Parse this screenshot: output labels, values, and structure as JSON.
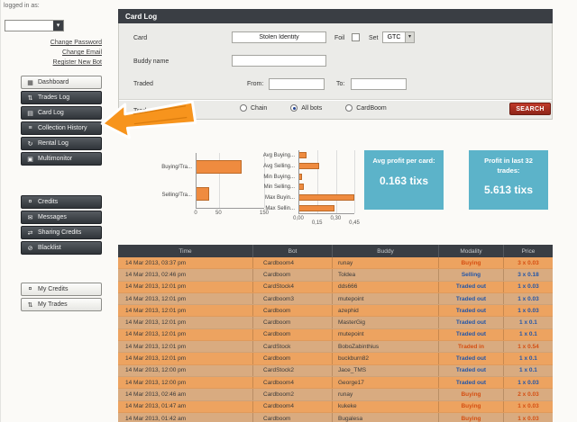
{
  "account": {
    "logged_in_label": "logged in as:",
    "links": [
      "Change Password",
      "Change Email",
      "Register New Bot"
    ]
  },
  "sidebar": {
    "groups": [
      [
        {
          "name": "dashboard",
          "label": "Dashboard",
          "icon": "dashboard-icon",
          "glyph": "▦",
          "style": "light"
        },
        {
          "name": "trades-log",
          "label": "Trades Log",
          "icon": "trades-icon",
          "glyph": "⇅",
          "style": "dark"
        },
        {
          "name": "card-log",
          "label": "Card Log",
          "icon": "card-icon",
          "glyph": "▤",
          "style": "dark"
        },
        {
          "name": "collection-history",
          "label": "Collection History",
          "icon": "history-icon",
          "glyph": "≡",
          "style": "dark"
        },
        {
          "name": "rental-log",
          "label": "Rental Log",
          "icon": "rental-icon",
          "glyph": "↻",
          "style": "dark"
        },
        {
          "name": "multimonitor",
          "label": "Multimonitor",
          "icon": "monitor-icon",
          "glyph": "▣",
          "style": "dark"
        }
      ],
      [
        {
          "name": "credits",
          "label": "Credits",
          "icon": "credits-icon",
          "glyph": "¤",
          "style": "dark"
        },
        {
          "name": "messages",
          "label": "Messages",
          "icon": "messages-icon",
          "glyph": "✉",
          "style": "dark"
        },
        {
          "name": "sharing-credits",
          "label": "Sharing Credits",
          "icon": "sharing-icon",
          "glyph": "⇄",
          "style": "dark"
        },
        {
          "name": "blacklist",
          "label": "Blacklist",
          "icon": "blacklist-icon",
          "glyph": "⊘",
          "style": "dark"
        }
      ],
      [
        {
          "name": "my-credits",
          "label": "My Credits",
          "icon": "my-credits-icon",
          "glyph": "¤",
          "style": "light"
        },
        {
          "name": "my-trades",
          "label": "My Trades",
          "icon": "my-trades-icon",
          "glyph": "⇅",
          "style": "light"
        }
      ]
    ]
  },
  "form": {
    "title": "Card Log",
    "card_label": "Card",
    "card_value": "Stolen Identity",
    "foil_label": "Foil",
    "foil_checked": false,
    "set_label": "Set",
    "set_value": "GTC",
    "buddy_label": "Buddy name",
    "buddy_value": "",
    "traded_label": "Traded",
    "from_label": "From:",
    "from_value": "",
    "to_label": "To:",
    "to_value": "",
    "trades_for_label": "Trades for",
    "trades_for_options": [
      {
        "label": "Chain",
        "selected": false
      },
      {
        "label": "All bots",
        "selected": true
      },
      {
        "label": "CardBoom",
        "selected": false
      }
    ],
    "search_label": "SEARCH"
  },
  "chart_data": [
    {
      "type": "bar",
      "orientation": "horizontal",
      "title": "",
      "categories": [
        "Buying/Tra...",
        "Selling/Tra..."
      ],
      "values": [
        100,
        28
      ],
      "xlim": [
        0,
        150
      ],
      "tick_labels": [
        "0",
        "50",
        "150"
      ],
      "tick_values": [
        0,
        50,
        150
      ],
      "stagger_ticks": false,
      "bar_color": "#ef8b3f",
      "grid": true,
      "legend": "none"
    },
    {
      "type": "bar",
      "orientation": "horizontal",
      "title": "",
      "categories": [
        "Avg Buying...",
        "Avg Selling...",
        "Min Buying...",
        "Min Selling...",
        "Max Buyin...",
        "Max Sellin..."
      ],
      "values": [
        0.06,
        0.16,
        0.02,
        0.04,
        0.45,
        0.29
      ],
      "xlim": [
        0,
        0.45
      ],
      "tick_labels": [
        "0,00",
        "0,15",
        "0,30",
        "0,45"
      ],
      "tick_values": [
        0,
        0.15,
        0.3,
        0.45
      ],
      "stagger_ticks": true,
      "bar_color": "#ef8b3f",
      "grid": true,
      "legend": "none"
    }
  ],
  "stats": [
    {
      "title": "Avg profit per card:",
      "value": "0.163 tixs"
    },
    {
      "title": "Profit in last 32 trades:",
      "value": "5.613 tixs"
    }
  ],
  "table": {
    "headers": [
      "Time",
      "Bot",
      "Buddy",
      "Modality",
      "Price"
    ],
    "rows": [
      {
        "time": "14 Mar 2013, 03:37 pm",
        "bot": "Cardboom4",
        "buddy": "runay",
        "modality": "Buying",
        "price": "3 x 0.03",
        "kind": "buy"
      },
      {
        "time": "14 Mar 2013, 02:46 pm",
        "bot": "Cardboom",
        "buddy": "Toldea",
        "modality": "Selling",
        "price": "3 x 0.18",
        "kind": "sell"
      },
      {
        "time": "14 Mar 2013, 12:01 pm",
        "bot": "CardStock4",
        "buddy": "dds666",
        "modality": "Traded out",
        "price": "1 x 0.03",
        "kind": "sell"
      },
      {
        "time": "14 Mar 2013, 12:01 pm",
        "bot": "Cardboom3",
        "buddy": "mutepoint",
        "modality": "Traded out",
        "price": "1 x 0.03",
        "kind": "sell"
      },
      {
        "time": "14 Mar 2013, 12:01 pm",
        "bot": "Cardboom",
        "buddy": "azephid",
        "modality": "Traded out",
        "price": "1 x 0.03",
        "kind": "sell"
      },
      {
        "time": "14 Mar 2013, 12:01 pm",
        "bot": "Cardboom",
        "buddy": "MasterGig",
        "modality": "Traded out",
        "price": "1 x 0.1",
        "kind": "sell"
      },
      {
        "time": "14 Mar 2013, 12:01 pm",
        "bot": "Cardboom",
        "buddy": "mutepoint",
        "modality": "Traded out",
        "price": "1 x 0.1",
        "kind": "sell"
      },
      {
        "time": "14 Mar 2013, 12:01 pm",
        "bot": "CardStock",
        "buddy": "BoboZabinthius",
        "modality": "Traded in",
        "price": "1 x 0.54",
        "kind": "buy"
      },
      {
        "time": "14 Mar 2013, 12:01 pm",
        "bot": "Cardboom",
        "buddy": "buckburn82",
        "modality": "Traded out",
        "price": "1 x 0.1",
        "kind": "sell"
      },
      {
        "time": "14 Mar 2013, 12:00 pm",
        "bot": "CardStock2",
        "buddy": "Jace_TMS",
        "modality": "Traded out",
        "price": "1 x 0.1",
        "kind": "sell"
      },
      {
        "time": "14 Mar 2013, 12:00 pm",
        "bot": "Cardboom4",
        "buddy": "George17",
        "modality": "Traded out",
        "price": "1 x 0.03",
        "kind": "sell"
      },
      {
        "time": "14 Mar 2013, 02:46 am",
        "bot": "Cardboom2",
        "buddy": "runay",
        "modality": "Buying",
        "price": "2 x 0.03",
        "kind": "buy"
      },
      {
        "time": "14 Mar 2013, 01:47 am",
        "bot": "Cardboom4",
        "buddy": "kukeke",
        "modality": "Buying",
        "price": "1 x 0.03",
        "kind": "buy"
      },
      {
        "time": "14 Mar 2013, 01:42 am",
        "bot": "Cardboom",
        "buddy": "Bugalesa",
        "modality": "Buying",
        "price": "1 x 0.03",
        "kind": "buy"
      }
    ]
  },
  "colors": {
    "panel_header": "#3a3e44",
    "bar_orange": "#ef8b3f",
    "stat_teal": "#5cb3c9",
    "search_red": "#a8332a",
    "buy_text": "#d54f12",
    "sell_text": "#2356a8",
    "row_odd": "#eda360",
    "row_even": "#d9ab80"
  }
}
